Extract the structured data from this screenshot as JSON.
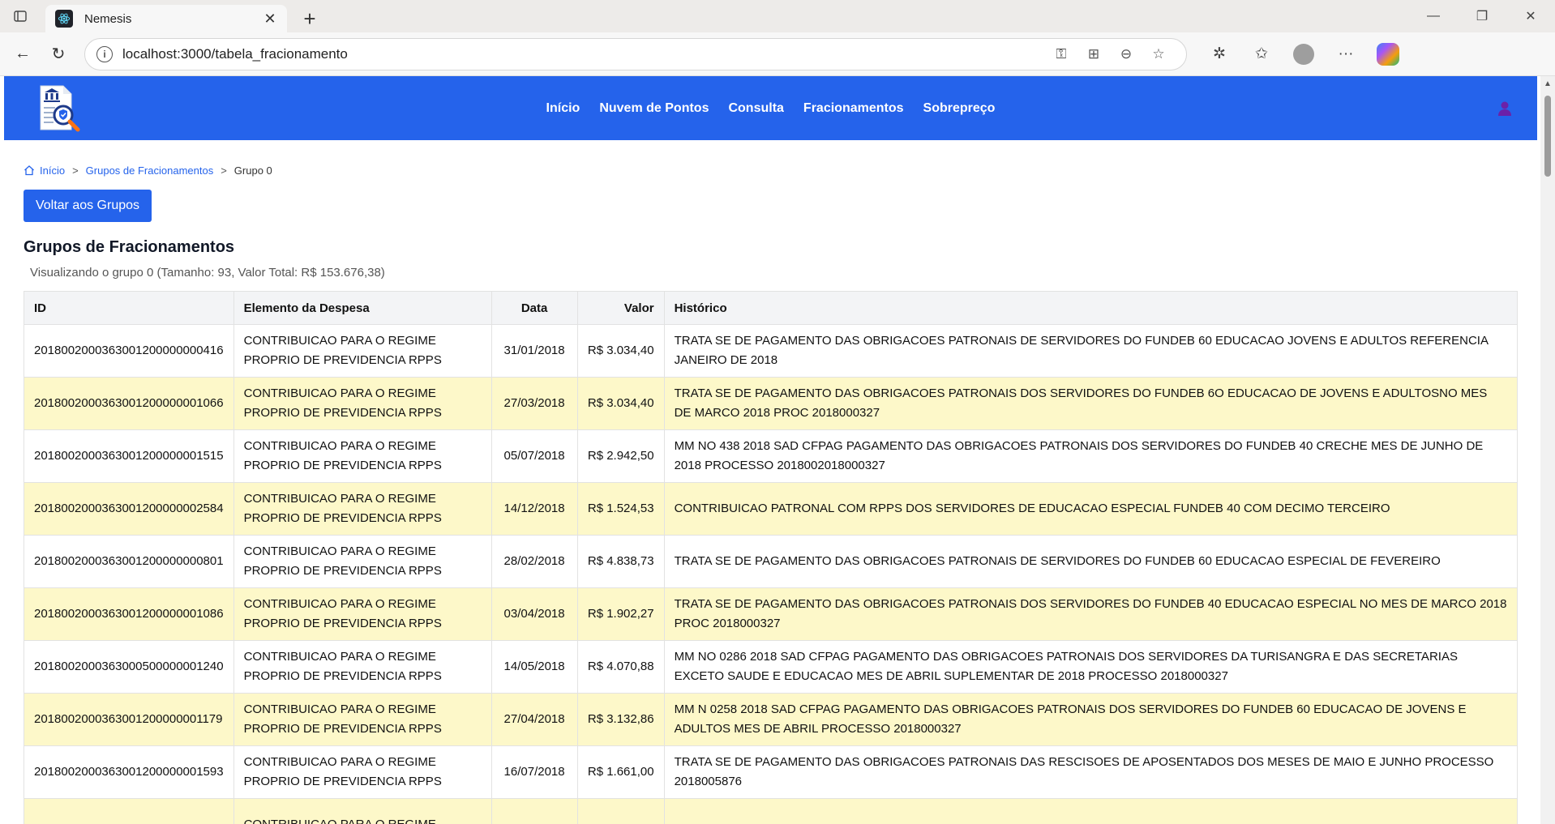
{
  "browser": {
    "tab_title": "Nemesis",
    "url": "localhost:3000/tabela_fracionamento"
  },
  "nav": {
    "links": [
      "Início",
      "Nuvem de Pontos",
      "Consulta",
      "Fracionamentos",
      "Sobrepreço"
    ]
  },
  "breadcrumb": {
    "home": "Início",
    "groups": "Grupos de Fracionamentos",
    "current": "Grupo 0",
    "separator": ">"
  },
  "back_button": "Voltar aos Grupos",
  "section_title": "Grupos de Fracionamentos",
  "subtitle": "Visualizando o grupo 0 (Tamanho: 93, Valor Total: R$ 153.676,38)",
  "table": {
    "headers": [
      "ID",
      "Elemento da Despesa",
      "Data",
      "Valor",
      "Histórico"
    ],
    "rows": [
      {
        "id": "2018002000363001200000000416",
        "elemento": "CONTRIBUICAO PARA O REGIME PROPRIO DE PREVIDENCIA RPPS",
        "data": "31/01/2018",
        "valor": "R$ 3.034,40",
        "historico": "TRATA SE DE PAGAMENTO DAS OBRIGACOES PATRONAIS DE SERVIDORES DO FUNDEB 60 EDUCACAO JOVENS E ADULTOS REFERENCIA JANEIRO DE 2018"
      },
      {
        "id": "2018002000363001200000001066",
        "elemento": "CONTRIBUICAO PARA O REGIME PROPRIO DE PREVIDENCIA RPPS",
        "data": "27/03/2018",
        "valor": "R$ 3.034,40",
        "historico": "TRATA SE DE PAGAMENTO DAS OBRIGACOES PATRONAIS DOS SERVIDORES DO FUNDEB 6O EDUCACAO DE JOVENS E ADULTOSNO MES DE MARCO 2018 PROC 2018000327"
      },
      {
        "id": "2018002000363001200000001515",
        "elemento": "CONTRIBUICAO PARA O REGIME PROPRIO DE PREVIDENCIA RPPS",
        "data": "05/07/2018",
        "valor": "R$ 2.942,50",
        "historico": "MM NO 438 2018 SAD CFPAG PAGAMENTO DAS OBRIGACOES PATRONAIS DOS SERVIDORES DO FUNDEB 40 CRECHE MES DE JUNHO DE 2018 PROCESSO 2018002018000327"
      },
      {
        "id": "2018002000363001200000002584",
        "elemento": "CONTRIBUICAO PARA O REGIME PROPRIO DE PREVIDENCIA RPPS",
        "data": "14/12/2018",
        "valor": "R$ 1.524,53",
        "historico": "CONTRIBUICAO PATRONAL COM RPPS DOS SERVIDORES DE EDUCACAO ESPECIAL FUNDEB 40 COM DECIMO TERCEIRO"
      },
      {
        "id": "2018002000363001200000000801",
        "elemento": "CONTRIBUICAO PARA O REGIME PROPRIO DE PREVIDENCIA RPPS",
        "data": "28/02/2018",
        "valor": "R$ 4.838,73",
        "historico": "TRATA SE DE PAGAMENTO DAS OBRIGACOES PATRONAIS DE SERVIDORES DO FUNDEB 60 EDUCACAO ESPECIAL DE FEVEREIRO"
      },
      {
        "id": "2018002000363001200000001086",
        "elemento": "CONTRIBUICAO PARA O REGIME PROPRIO DE PREVIDENCIA RPPS",
        "data": "03/04/2018",
        "valor": "R$ 1.902,27",
        "historico": "TRATA SE DE PAGAMENTO DAS OBRIGACOES PATRONAIS DOS SERVIDORES DO FUNDEB 40 EDUCACAO ESPECIAL NO MES DE MARCO 2018 PROC 2018000327"
      },
      {
        "id": "2018002000363000500000001240",
        "elemento": "CONTRIBUICAO PARA O REGIME PROPRIO DE PREVIDENCIA RPPS",
        "data": "14/05/2018",
        "valor": "R$ 4.070,88",
        "historico": "MM NO 0286 2018 SAD CFPAG PAGAMENTO DAS OBRIGACOES PATRONAIS DOS SERVIDORES DA TURISANGRA E DAS SECRETARIAS EXCETO SAUDE E EDUCACAO MES DE ABRIL SUPLEMENTAR DE 2018 PROCESSO 2018000327"
      },
      {
        "id": "2018002000363001200000001179",
        "elemento": "CONTRIBUICAO PARA O REGIME PROPRIO DE PREVIDENCIA RPPS",
        "data": "27/04/2018",
        "valor": "R$ 3.132,86",
        "historico": "MM N 0258 2018 SAD CFPAG PAGAMENTO DAS OBRIGACOES PATRONAIS DOS SERVIDORES DO FUNDEB 60 EDUCACAO DE JOVENS E ADULTOS MES DE ABRIL PROCESSO 2018000327"
      },
      {
        "id": "2018002000363001200000001593",
        "elemento": "CONTRIBUICAO PARA O REGIME PROPRIO DE PREVIDENCIA RPPS",
        "data": "16/07/2018",
        "valor": "R$ 1.661,00",
        "historico": "TRATA SE DE PAGAMENTO DAS OBRIGACOES PATRONAIS DAS RESCISOES DE APOSENTADOS DOS MESES DE MAIO E JUNHO PROCESSO 2018005876"
      },
      {
        "id": "",
        "elemento": "CONTRIBUICAO PARA O REGIME",
        "data": "",
        "valor": "",
        "historico": ""
      }
    ]
  },
  "colors": {
    "primary": "#2563eb",
    "row_alt": "#fdf8c9"
  },
  "icons": {
    "logo": "document-bank-search-icon",
    "user": "user-icon",
    "home": "home-icon"
  }
}
